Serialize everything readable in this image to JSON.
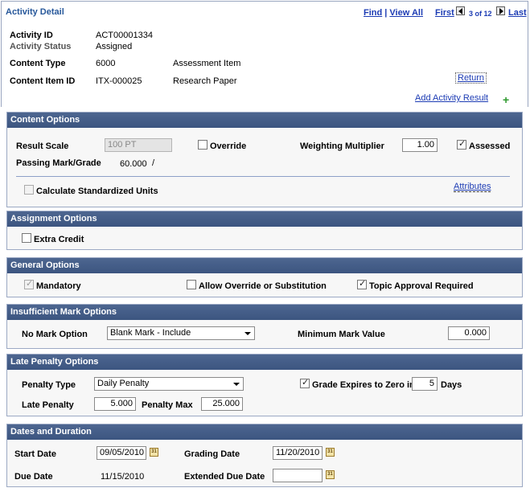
{
  "header": {
    "title": "Activity Detail",
    "find": "Find",
    "separator": "|",
    "view_all": "View All",
    "first": "First",
    "page_counter": "3 of 12",
    "last": "Last"
  },
  "activity": {
    "id_label": "Activity ID",
    "id_value": "ACT00001334",
    "status_label": "Activity Status",
    "status_value": "Assigned",
    "content_type_label": "Content Type",
    "content_type_code": "6000",
    "content_type_desc": "Assessment Item",
    "content_item_label": "Content Item ID",
    "content_item_code": "ITX-000025",
    "content_item_desc": "Research Paper",
    "return_link": "Return",
    "add_result_link": "Add Activity Result"
  },
  "content_options": {
    "title": "Content Options",
    "result_scale_label": "Result Scale",
    "result_scale_value": "100 PT",
    "override_label": "Override",
    "override_checked": false,
    "weighting_label": "Weighting Multiplier",
    "weighting_value": "1.00",
    "assessed_label": "Assessed",
    "assessed_checked": true,
    "passing_label": "Passing Mark/Grade",
    "passing_value": "60.000",
    "passing_sep": "/",
    "calc_label": "Calculate Standardized Units",
    "calc_checked": false,
    "attributes_link": "Attributes"
  },
  "assignment_options": {
    "title": "Assignment Options",
    "extra_credit_label": "Extra Credit",
    "extra_credit_checked": false
  },
  "general_options": {
    "title": "General Options",
    "mandatory_label": "Mandatory",
    "mandatory_checked": true,
    "allow_override_label": "Allow Override or Substitution",
    "allow_override_checked": false,
    "topic_approval_label": "Topic Approval Required",
    "topic_approval_checked": true
  },
  "insufficient_mark": {
    "title": "Insufficient Mark Options",
    "no_mark_label": "No Mark Option",
    "no_mark_value": "Blank Mark - Include",
    "min_mark_label": "Minimum Mark Value",
    "min_mark_value": "0.000"
  },
  "late_penalty": {
    "title": "Late Penalty Options",
    "penalty_type_label": "Penalty Type",
    "penalty_type_value": "Daily Penalty",
    "grade_expires_label": "Grade Expires to Zero in",
    "grade_expires_checked": true,
    "days_value": "5",
    "days_label": "Days",
    "late_penalty_label": "Late Penalty",
    "late_penalty_value": "5.000",
    "penalty_max_label": "Penalty Max",
    "penalty_max_value": "25.000"
  },
  "dates": {
    "title": "Dates and Duration",
    "start_label": "Start Date",
    "start_value": "09/05/2010",
    "grading_label": "Grading Date",
    "grading_value": "11/20/2010",
    "due_label": "Due Date",
    "due_value": "11/15/2010",
    "extended_label": "Extended Due Date",
    "extended_value": "",
    "calendar_icon": "calendar-icon"
  }
}
